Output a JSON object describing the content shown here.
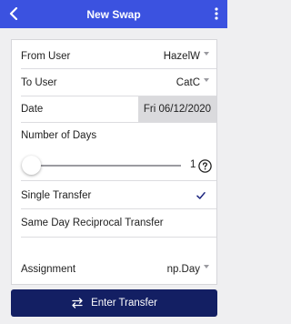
{
  "header": {
    "title": "New Swap",
    "back_icon": "chevron-left-icon",
    "menu_icon": "more-vertical-icon",
    "color": "#3b52e0"
  },
  "form": {
    "from_user": {
      "label": "From User",
      "value": "HazelW"
    },
    "to_user": {
      "label": "To User",
      "value": "CatC"
    },
    "date": {
      "label": "Date",
      "value": "Fri 06/12/2020"
    },
    "number_of_days": {
      "label": "Number of Days",
      "value": "1",
      "help_icon": "question-circle-icon"
    },
    "single_transfer": {
      "label": "Single Transfer",
      "checked": true,
      "icon": "checkmark-icon"
    },
    "same_day_reciprocal": {
      "label": "Same Day Reciprocal Transfer",
      "checked": false
    },
    "assignment": {
      "label": "Assignment",
      "value": "np.Day"
    }
  },
  "footer": {
    "enter_button_label": "Enter Transfer",
    "enter_icon": "swap-arrows-icon",
    "color": "#131f63"
  }
}
